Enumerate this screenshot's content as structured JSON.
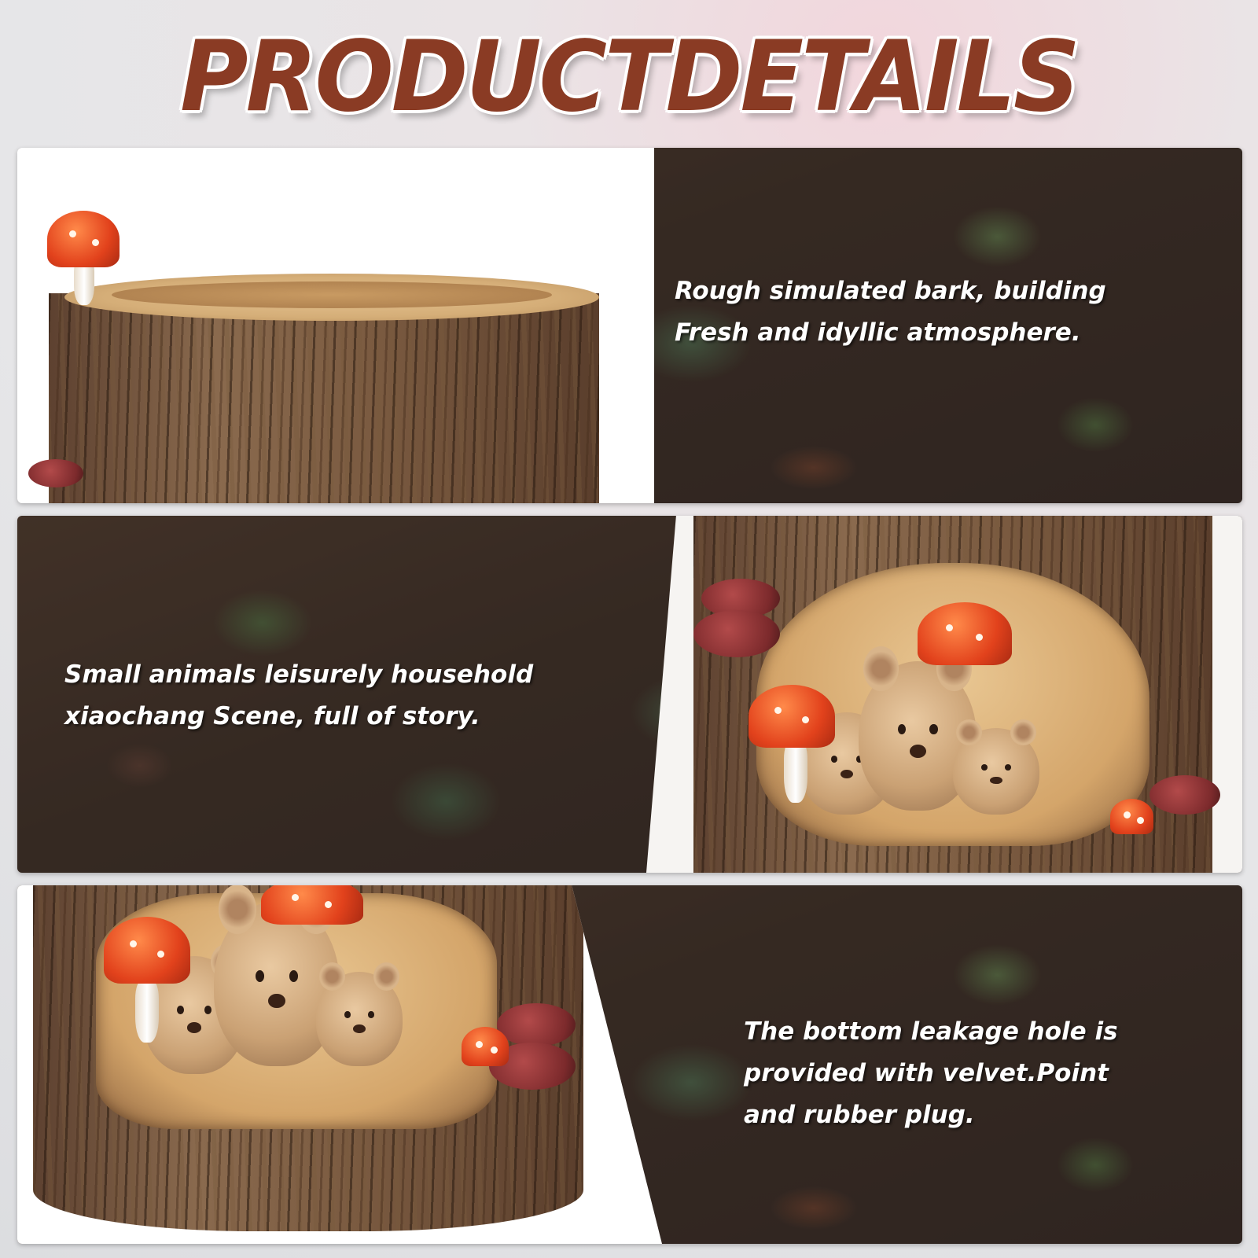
{
  "title": "PRODUCTDETAILS",
  "panels": [
    {
      "caption_lines": [
        "Rough simulated bark, building",
        "Fresh and idyllic atmosphere."
      ]
    },
    {
      "caption_lines": [
        "Small animals leisurely household",
        "xiaochang Scene, full of story."
      ]
    },
    {
      "caption_lines": [
        "The bottom leakage hole is",
        "provided with velvet.Point",
        "and rubber plug."
      ]
    }
  ],
  "colors": {
    "title": "#8a3b24",
    "caption": "#ffffff",
    "mushroom": "#e2421c",
    "bark": "#7a5a40"
  }
}
